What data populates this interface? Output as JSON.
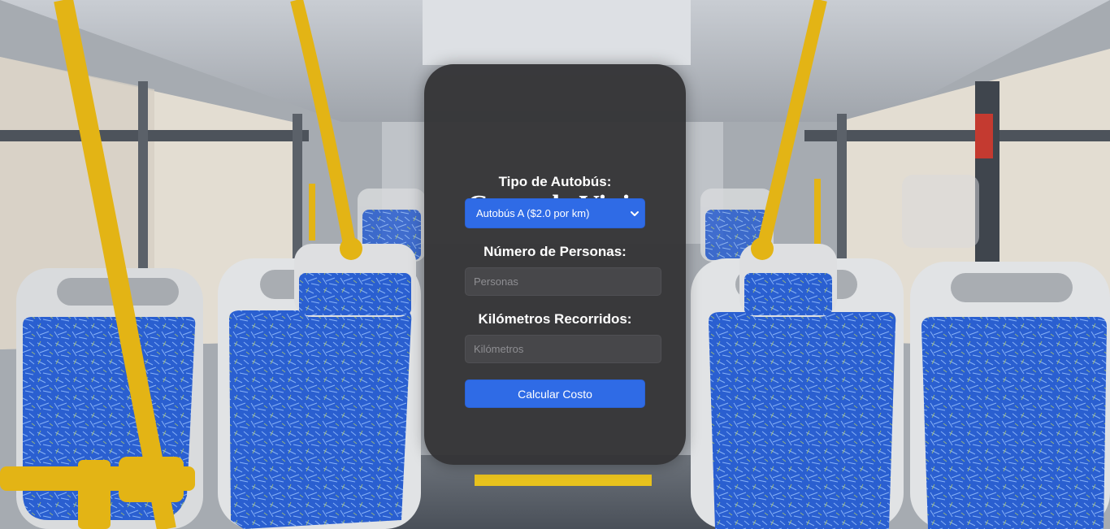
{
  "form": {
    "title": "Costo de Viaje",
    "bus_type_label": "Tipo de Autobús:",
    "bus_type_selected": "Autobús A ($2.0 por km)",
    "people_label": "Número de Personas:",
    "people_placeholder": "Personas",
    "km_label": "Kilómetros Recorridos:",
    "km_placeholder": "Kilómetros",
    "submit_label": "Calcular Costo"
  },
  "colors": {
    "accent": "#2f6be6",
    "card": "#343436",
    "input_bg": "#47474a",
    "seat_blue": "#2a5fd0",
    "pole_yellow": "#e3b415"
  },
  "icons": {
    "select_arrow": "chevron-down-icon"
  }
}
